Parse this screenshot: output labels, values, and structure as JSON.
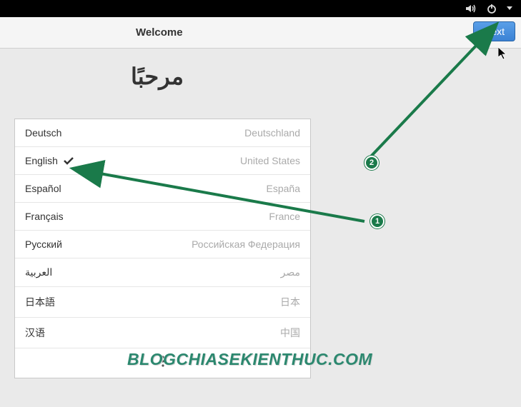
{
  "header": {
    "title": "Welcome",
    "next_label": "Next"
  },
  "welcome_heading": "مرحبًا",
  "languages": [
    {
      "name": "Deutsch",
      "country": "Deutschland",
      "selected": false
    },
    {
      "name": "English",
      "country": "United States",
      "selected": true
    },
    {
      "name": "Español",
      "country": "España",
      "selected": false
    },
    {
      "name": "Français",
      "country": "France",
      "selected": false
    },
    {
      "name": "Русский",
      "country": "Российская Федерация",
      "selected": false
    },
    {
      "name": "العربية",
      "country": "مصر",
      "selected": false
    },
    {
      "name": "日本語",
      "country": "日本",
      "selected": false
    },
    {
      "name": "汉语",
      "country": "中国",
      "selected": false
    }
  ],
  "annotations": {
    "badge1": "1",
    "badge2": "2",
    "watermark": "BLOGCHIASEKIENTHUC.COM"
  }
}
